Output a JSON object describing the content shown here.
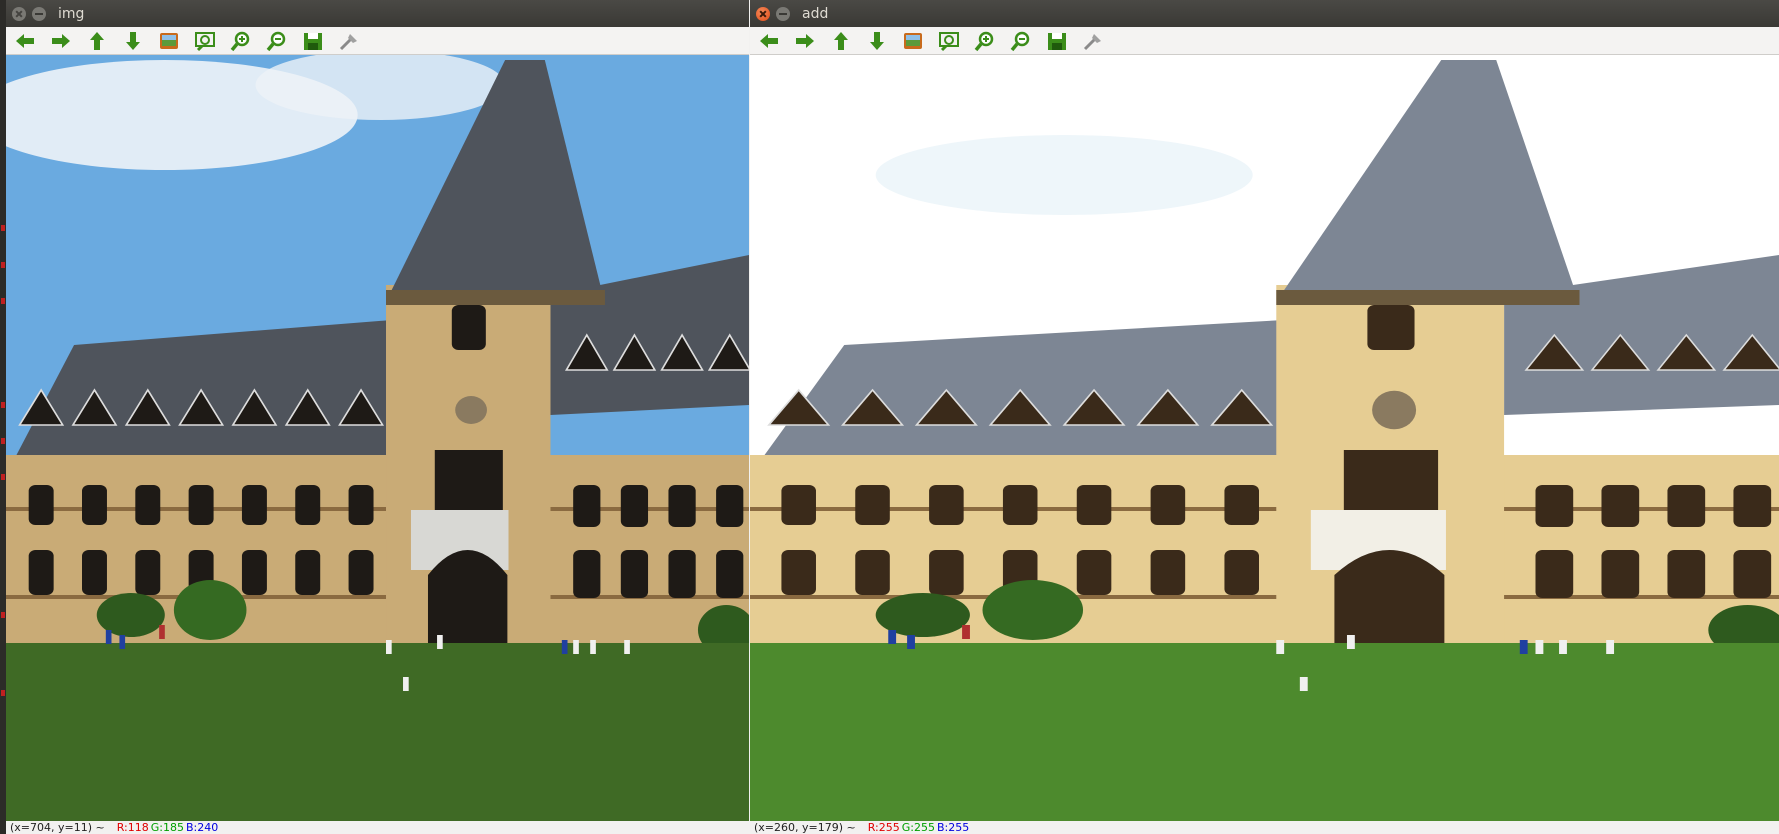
{
  "windows": [
    {
      "id": "img",
      "title": "img",
      "close_active": false,
      "toolbar": [
        "arrow-left-icon",
        "arrow-right-icon",
        "arrow-up-icon",
        "arrow-down-icon",
        "picture-icon",
        "zoom-fit-icon",
        "zoom-in-icon",
        "zoom-out-icon",
        "save-icon",
        "properties-icon"
      ],
      "status": {
        "coords": "(x=704, y=11) ~",
        "r": "R:118",
        "g": "G:185",
        "b": "B:240"
      },
      "image": {
        "sky_color": "#6aaae0",
        "brightened": false
      }
    },
    {
      "id": "add",
      "title": "add",
      "close_active": true,
      "toolbar": [
        "arrow-left-icon",
        "arrow-right-icon",
        "arrow-up-icon",
        "arrow-down-icon",
        "picture-icon",
        "zoom-fit-icon",
        "zoom-in-icon",
        "zoom-out-icon",
        "save-icon",
        "properties-icon"
      ],
      "status": {
        "coords": "(x=260, y=179) ~",
        "r": "R:255",
        "g": "G:255",
        "b": "B:255"
      },
      "image": {
        "sky_color": "#ffffff",
        "brightened": true
      }
    }
  ],
  "colors": {
    "icon_green": "#3b8d1a",
    "stone": "#c9ab76",
    "stone_bright": "#e6cd93",
    "roof": "#4f545c",
    "roof_bright": "#7d8694",
    "grass": "#3f6a25",
    "grass_bright": "#4d8a2d"
  }
}
